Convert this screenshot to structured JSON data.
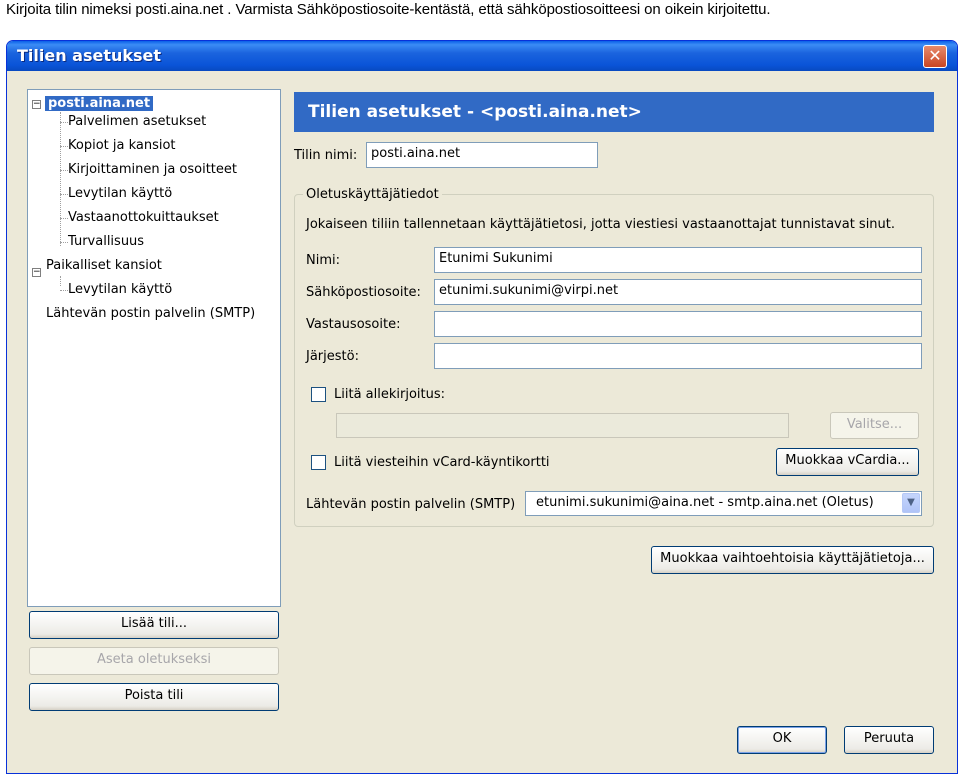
{
  "instruction": "Kirjoita tilin nimeksi posti.aina.net . Varmista Sähköpostiosoite-kentästä, että sähköpostiosoitteesi on oikein kirjoitettu.",
  "window": {
    "title": "Tilien asetukset",
    "close_glyph": "✕"
  },
  "tree": {
    "account": "posti.aina.net",
    "account_children": [
      "Palvelimen asetukset",
      "Kopiot ja kansiot",
      "Kirjoittaminen ja osoitteet",
      "Levytilan käyttö",
      "Vastaanottokuittaukset",
      "Turvallisuus"
    ],
    "local": "Paikalliset kansiot",
    "local_children": [
      "Levytilan käyttö"
    ],
    "smtp": "Lähtevän postin palvelin (SMTP)"
  },
  "left_buttons": {
    "add": "Lisää tili...",
    "set_default": "Aseta oletukseksi",
    "remove": "Poista tili"
  },
  "header": "Tilien asetukset - <posti.aina.net>",
  "account_name": {
    "label": "Tilin nimi:",
    "value": "posti.aina.net"
  },
  "identity": {
    "legend": "Oletuskäyttäjätiedot",
    "description": "Jokaiseen tiliin tallennetaan käyttäjätietosi, jotta viestiesi vastaanottajat tunnistavat sinut.",
    "name_label": "Nimi:",
    "name_value": "Etunimi Sukunimi",
    "email_label": "Sähköpostiosoite:",
    "email_value": "etunimi.sukunimi@virpi.net",
    "reply_label": "Vastausosoite:",
    "reply_value": "",
    "org_label": "Järjestö:",
    "org_value": "",
    "signature_label": "Liitä allekirjoitus:",
    "signature_value": "",
    "choose_button": "Valitse...",
    "vcard_label": "Liitä viesteihin vCard-käyntikortti",
    "vcard_button": "Muokkaa vCardia...",
    "smtp_label": "Lähtevän postin palvelin (SMTP)",
    "smtp_value": "etunimi.sukunimi@aina.net - smtp.aina.net (Oletus)"
  },
  "edit_identities_button": "Muokkaa vaihtoehtoisia käyttäjätietoja...",
  "ok_button": "OK",
  "cancel_button": "Peruuta"
}
